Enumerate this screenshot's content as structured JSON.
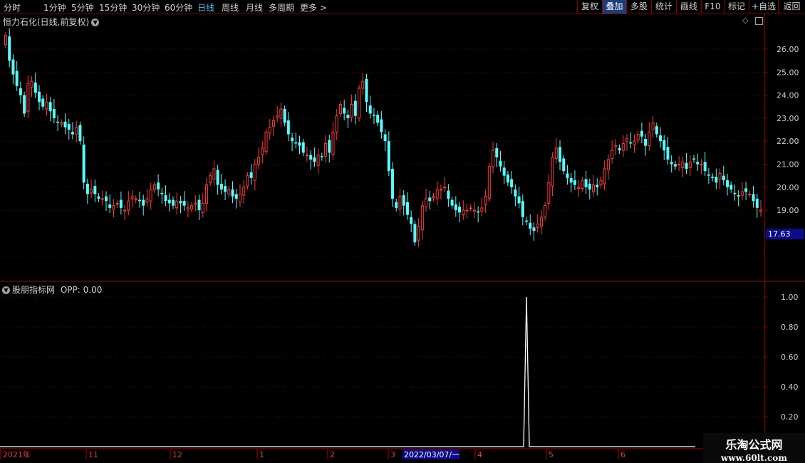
{
  "toolbar": {
    "timeframes": [
      {
        "label": "分时",
        "active": false
      },
      {
        "label": "1分钟",
        "active": false
      },
      {
        "label": "5分钟",
        "active": false
      },
      {
        "label": "15分钟",
        "active": false
      },
      {
        "label": "30分钟",
        "active": false
      },
      {
        "label": "60分钟",
        "active": false
      },
      {
        "label": "日线",
        "active": true
      },
      {
        "label": "周线",
        "active": false
      },
      {
        "label": "月线",
        "active": false
      },
      {
        "label": "多周期",
        "active": false
      },
      {
        "label": "更多 >",
        "active": false
      }
    ],
    "right_buttons": [
      {
        "label": "复权",
        "highlight": false
      },
      {
        "label": "叠加",
        "highlight": true
      },
      {
        "label": "多股",
        "highlight": false
      },
      {
        "label": "统计",
        "highlight": false
      },
      {
        "label": "画线",
        "highlight": false
      },
      {
        "label": "F10",
        "highlight": false
      },
      {
        "label": "标记",
        "highlight": false
      },
      {
        "label": "+自选",
        "highlight": false
      },
      {
        "label": "返回",
        "highlight": false
      }
    ]
  },
  "main_chart": {
    "title": "恒力石化(日线,前复权)",
    "last_price_tag": "17.63",
    "y_ticks": [
      26,
      25,
      24,
      23,
      22,
      21,
      20,
      19
    ],
    "y_tick_labels": [
      "26.00",
      "25.00",
      "24.00",
      "23.00",
      "22.00",
      "21.00",
      "20.00",
      "19.00"
    ]
  },
  "indicator": {
    "label": "股朋指标网",
    "value_text": "OPP: 0.00",
    "y_tick_labels": [
      "1.00",
      "0.80",
      "0.60",
      "0.40",
      "0.20"
    ],
    "spike_value": 1.0
  },
  "x_axis": {
    "labels": [
      "2021年",
      "11",
      "12",
      "1",
      "2",
      "3",
      "4",
      "5",
      "6"
    ],
    "cursor_date": "2022/03/07/一"
  },
  "watermark": {
    "line1": "乐淘公式网",
    "line2": "www.60lt.com"
  },
  "colors": {
    "up": "#ff3b3b",
    "down": "#54ffff",
    "axis": "#b00000",
    "grid": "#5a0000",
    "line": "#ffffff"
  },
  "chart_data": {
    "type": "candlestick",
    "ylim": [
      16.2,
      27.0
    ],
    "closes": [
      26.6,
      25.5,
      24.9,
      24.4,
      24.0,
      23.2,
      24.5,
      24.6,
      24.1,
      23.7,
      23.5,
      23.7,
      23.3,
      23.0,
      22.8,
      22.8,
      22.6,
      22.5,
      22.3,
      22.6,
      22.0,
      20.2,
      19.7,
      19.9,
      19.7,
      19.5,
      19.5,
      19.4,
      19.1,
      19.2,
      19.3,
      19.1,
      19.0,
      19.4,
      19.6,
      19.5,
      19.4,
      19.2,
      19.5,
      19.9,
      20.1,
      19.9,
      19.7,
      19.4,
      19.3,
      19.2,
      19.4,
      19.3,
      19.2,
      19.1,
      19.2,
      19.3,
      19.0,
      19.3,
      20.1,
      20.5,
      20.8,
      20.1,
      19.9,
      19.8,
      19.9,
      19.6,
      19.5,
      19.7,
      20.0,
      20.5,
      20.4,
      21.0,
      21.3,
      21.7,
      22.4,
      22.6,
      22.9,
      23.1,
      23.4,
      22.8,
      22.3,
      22.0,
      21.9,
      21.8,
      21.5,
      21.4,
      21.2,
      21.1,
      21.4,
      21.3,
      21.9,
      21.5,
      22.4,
      23.1,
      23.6,
      23.2,
      23.0,
      23.6,
      23.1,
      24.3,
      24.6,
      23.7,
      23.2,
      23.1,
      22.8,
      22.4,
      22.0,
      20.7,
      19.5,
      19.1,
      19.6,
      19.2,
      18.8,
      18.4,
      17.6,
      18.3,
      19.2,
      19.5,
      19.4,
      19.6,
      19.9,
      19.9,
      20.0,
      19.5,
      19.2,
      19.0,
      18.9,
      19.0,
      19.0,
      19.1,
      19.0,
      18.9,
      19.1,
      19.6,
      20.9,
      21.6,
      21.3,
      20.9,
      20.5,
      20.2,
      20.0,
      19.6,
      19.3,
      18.7,
      18.5,
      18.2,
      18.1,
      18.4,
      18.7,
      19.2,
      20.2,
      21.3,
      21.7,
      21.1,
      20.7,
      20.4,
      20.2,
      20.1,
      20.0,
      20.3,
      20.0,
      19.9,
      20.1,
      20.0,
      20.3,
      20.8,
      21.2,
      21.6,
      21.8,
      21.6,
      21.9,
      22.1,
      21.9,
      22.0,
      22.3,
      22.2,
      21.8,
      22.4,
      22.8,
      22.3,
      22.0,
      21.6,
      21.2,
      21.0,
      20.9,
      21.0,
      21.1,
      20.8,
      21.1,
      21.2,
      21.0,
      21.0,
      20.7,
      20.5,
      20.4,
      20.2,
      20.6,
      20.3,
      20.0,
      19.9,
      19.7,
      19.6,
      19.8,
      19.8,
      19.7,
      19.4,
      19.1,
      19.0
    ],
    "spike_index": 140
  }
}
